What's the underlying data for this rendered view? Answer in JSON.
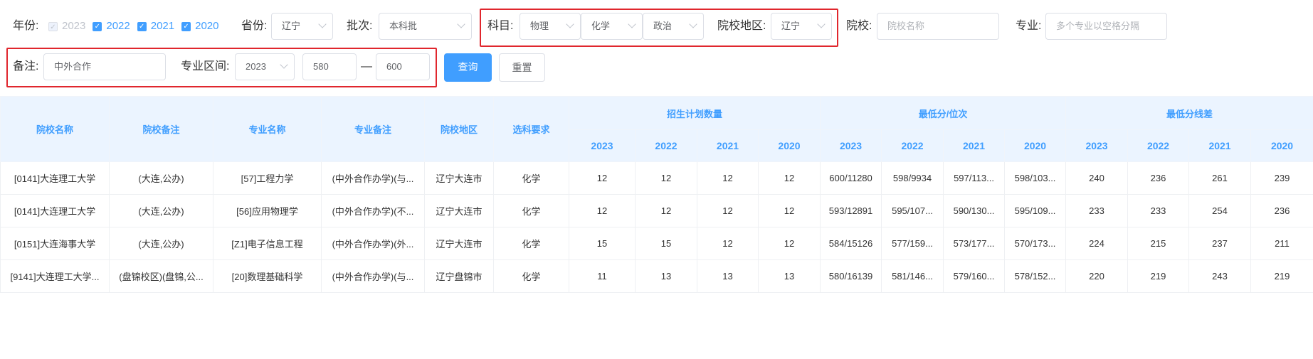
{
  "filters": {
    "year_label": "年份:",
    "years": [
      {
        "label": "2023",
        "checked": true,
        "disabled": true
      },
      {
        "label": "2022",
        "checked": true
      },
      {
        "label": "2021",
        "checked": true
      },
      {
        "label": "2020",
        "checked": true
      }
    ],
    "province_label": "省份:",
    "province": "辽宁",
    "batch_label": "批次:",
    "batch": "本科批",
    "subject_label": "科目:",
    "subjects": [
      "物理",
      "化学",
      "政治"
    ],
    "region_label": "院校地区:",
    "region": "辽宁",
    "school_label": "院校:",
    "school_placeholder": "院校名称",
    "major_label": "专业:",
    "major_placeholder": "多个专业以空格分隔",
    "note_label": "备注:",
    "note": "中外合作",
    "range_label": "专业区间:",
    "range_year": "2023",
    "range_min": "580",
    "range_dash": "—",
    "range_max": "600",
    "search_button": "查询",
    "reset_button": "重置"
  },
  "table": {
    "headers": [
      "院校名称",
      "院校备注",
      "专业名称",
      "专业备注",
      "院校地区",
      "选科要求"
    ],
    "groups": [
      "招生计划数量",
      "最低分/位次",
      "最低分线差"
    ],
    "years": [
      "2023",
      "2022",
      "2021",
      "2020"
    ],
    "rows": [
      [
        "[0141]大连理工大学",
        "(大连,公办)",
        "[57]工程力学",
        "(中外合作办学)(与...",
        "辽宁大连市",
        "化学",
        "12",
        "12",
        "12",
        "12",
        "600/11280",
        "598/9934",
        "597/113...",
        "598/103...",
        "240",
        "236",
        "261",
        "239"
      ],
      [
        "[0141]大连理工大学",
        "(大连,公办)",
        "[56]应用物理学",
        "(中外合作办学)(不...",
        "辽宁大连市",
        "化学",
        "12",
        "12",
        "12",
        "12",
        "593/12891",
        "595/107...",
        "590/130...",
        "595/109...",
        "233",
        "233",
        "254",
        "236"
      ],
      [
        "[0151]大连海事大学",
        "(大连,公办)",
        "[Z1]电子信息工程",
        "(中外合作办学)(外...",
        "辽宁大连市",
        "化学",
        "15",
        "15",
        "12",
        "12",
        "584/15126",
        "577/159...",
        "573/177...",
        "570/173...",
        "224",
        "215",
        "237",
        "211"
      ],
      [
        "[9141]大连理工大学...",
        "(盘锦校区)(盘锦,公...",
        "[20]数理基础科学",
        "(中外合作办学)(与...",
        "辽宁盘锦市",
        "化学",
        "11",
        "13",
        "13",
        "13",
        "580/16139",
        "581/146...",
        "579/160...",
        "578/152...",
        "220",
        "219",
        "243",
        "219"
      ]
    ]
  }
}
